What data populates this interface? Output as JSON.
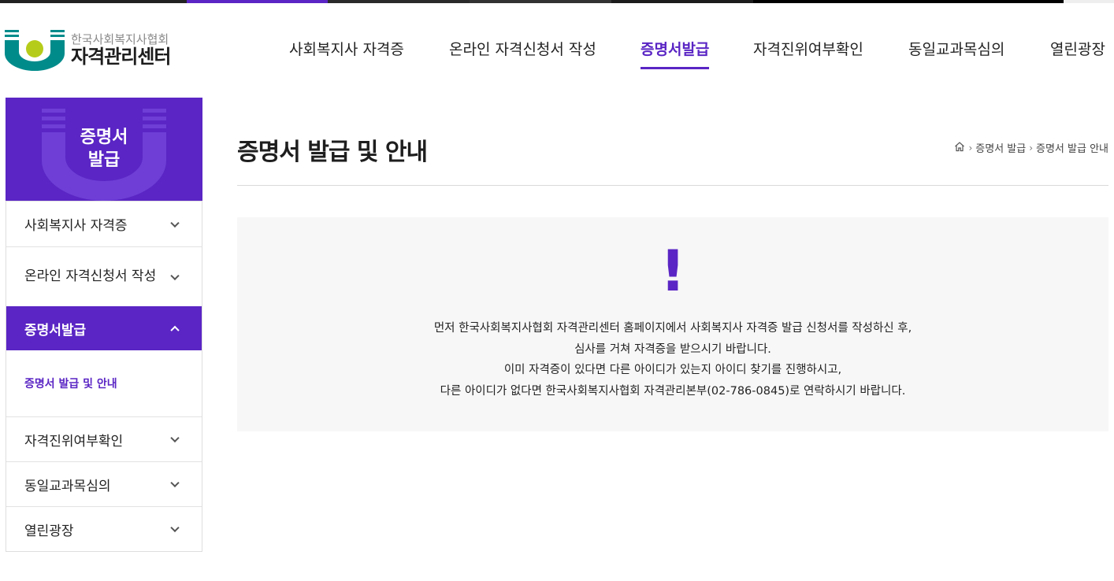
{
  "colors": {
    "brand_purple": "#5a25c4",
    "logo_teal": "#008b8b",
    "logo_lime": "#b6cc1a",
    "notice_bg": "#f7f7f7"
  },
  "logo": {
    "sub": "한국사회복지사협회",
    "main": "자격관리센터"
  },
  "gnb": {
    "items": [
      {
        "label": "사회복지사 자격증"
      },
      {
        "label": "온라인 자격신청서 작성"
      },
      {
        "label": "증명서발급"
      },
      {
        "label": "자격진위여부확인"
      },
      {
        "label": "동일교과목심의"
      },
      {
        "label": "열린광장"
      }
    ]
  },
  "lnb": {
    "title": "증명서\n발급",
    "items": [
      {
        "label": "사회복지사 자격증"
      },
      {
        "label": "온라인 자격신청서 작성"
      },
      {
        "label": "증명서발급"
      },
      {
        "label": "자격진위여부확인"
      },
      {
        "label": "동일교과목심의"
      },
      {
        "label": "열린광장"
      }
    ],
    "sub_items": [
      {
        "label": "증명서 발급 및 안내"
      }
    ]
  },
  "page": {
    "title": "증명서 발급 및 안내",
    "breadcrumb": [
      "증명서 발급",
      "증명서 발급 안내"
    ]
  },
  "notice": {
    "mark": "!",
    "lines": [
      "먼저 한국사회복지사협회 자격관리센터 홈페이지에서 사회복지사 자격증 발급 신청서를 작성하신 후,",
      "심사를 거쳐 자격증을 받으시기 바랍니다.",
      "이미 자격증이 있다면 다른 아이디가 있는지 아이디 찾기를 진행하시고,",
      "다른 아이디가 없다면 한국사회복지사협회 자격관리본부(02-786-0845)로 연락하시기 바랍니다."
    ]
  }
}
